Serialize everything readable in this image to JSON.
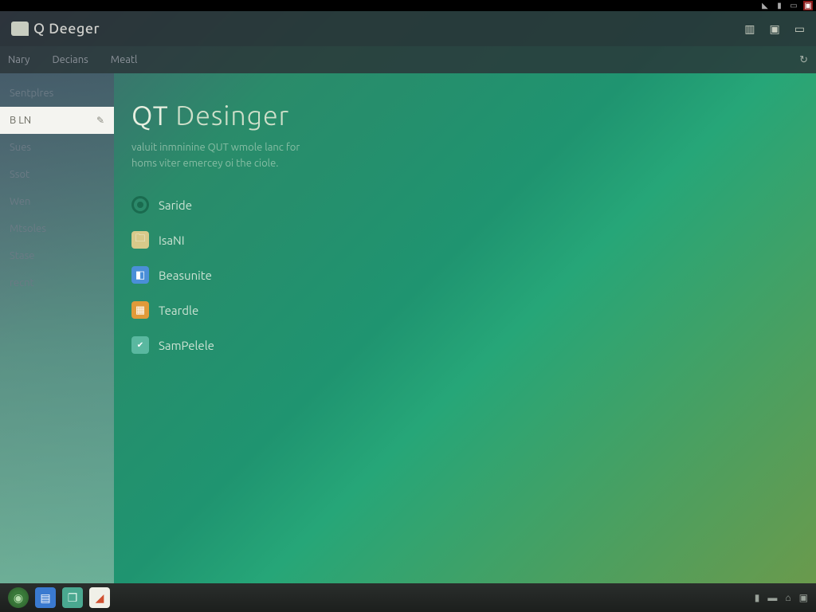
{
  "titlebar": {
    "app_name": "Q Deeger"
  },
  "menubar": {
    "items": [
      "Nary",
      "Decians",
      "Meatl"
    ]
  },
  "sidebar": {
    "items": [
      {
        "label": "Sentplres",
        "active": false
      },
      {
        "label": "B LN",
        "active": true
      },
      {
        "label": "Sues",
        "active": false
      },
      {
        "label": "Ssot",
        "active": false
      },
      {
        "label": "Wen",
        "active": false
      },
      {
        "label": "Mtsoles",
        "active": false
      },
      {
        "label": "Stase",
        "active": false
      },
      {
        "label": "recnt",
        "active": false
      }
    ]
  },
  "main": {
    "title_bold": "QT",
    "title_rest": " Desinger",
    "subtitle_line1": "valuit inmninine QUT wmole lanc for",
    "subtitle_line2": "homs viter emercey oi the ciole.",
    "options": [
      {
        "kind": "radio",
        "label": "Saride"
      },
      {
        "kind": "folder",
        "label": "IsaNI"
      },
      {
        "kind": "blue",
        "label": "Beasunite"
      },
      {
        "kind": "orange",
        "label": "Teardle"
      },
      {
        "kind": "teal",
        "label": "SamPelele"
      }
    ]
  }
}
